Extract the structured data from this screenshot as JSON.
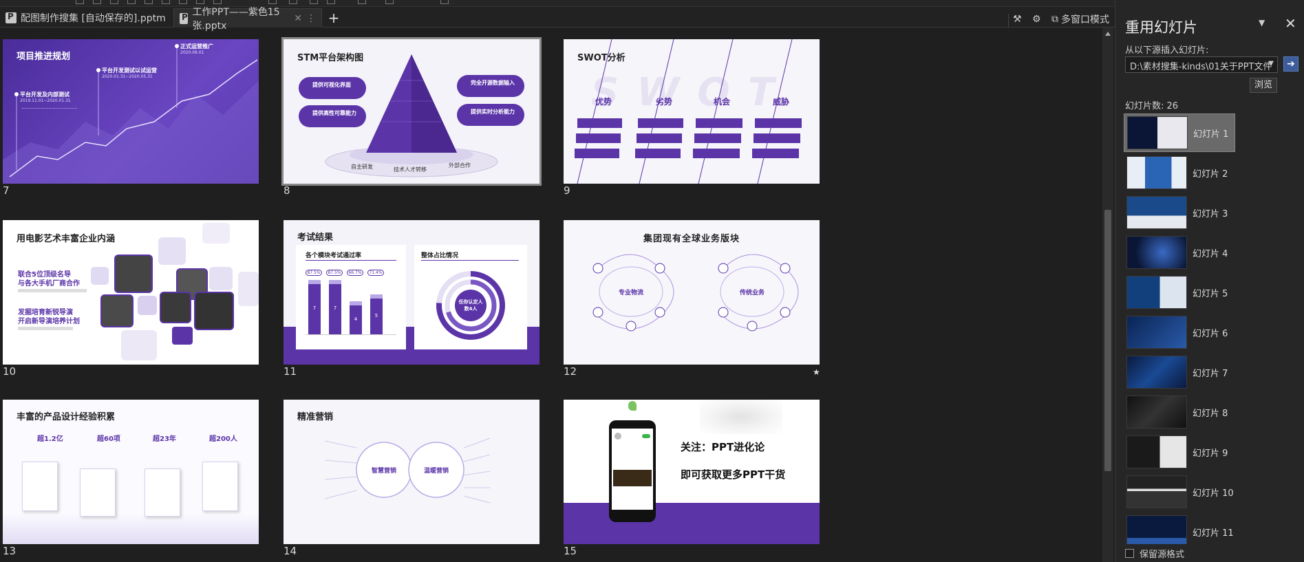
{
  "tabs": [
    {
      "label": "配图制作搜集 [自动保存的].pptm",
      "active": false
    },
    {
      "label": "工作PPT——紫色15张.pptx",
      "active": true
    }
  ],
  "toolbar": {
    "multiwindow": "多窗口模式"
  },
  "colors": {
    "accent": "#5b34a8",
    "panel_bg": "#262626",
    "app_bg": "#1f1f1f"
  },
  "slides": [
    {
      "num": "7",
      "title": "项目推进规划",
      "milestones": [
        "正式运营推广",
        "2020.06.01",
        "平台开发测试以试运营",
        "2020.01.31~2020.05.31",
        "平台开发及内部测试",
        "2019.11.01~2020.01.31"
      ]
    },
    {
      "num": "8",
      "title": "STM平台架构图",
      "left_boxes": [
        "提供可视化界面",
        "提供高性可靠能力"
      ],
      "right_boxes": [
        "完全开源数据输入",
        "提供实时分析能力"
      ],
      "base_labels": [
        "自主研发",
        "技术人才转移",
        "外部合作"
      ]
    },
    {
      "num": "9",
      "title": "SWOT分析",
      "columns": [
        "优势",
        "劣势",
        "机会",
        "威胁"
      ],
      "watermark": "SWOT"
    },
    {
      "num": "10",
      "title": "用电影艺术丰富企业内涵",
      "text1": "联合5位顶级名导",
      "text2": "与各大手机厂商合作",
      "text3": "发掘培育新锐导演",
      "text4": "开启新导演培养计划"
    },
    {
      "num": "11",
      "title": "考试结果",
      "left_sub": "各个模块考试通过率",
      "right_sub": "整体占比情况",
      "percents": [
        "87.5%",
        "87.5%",
        "66.7%",
        "71.4%"
      ],
      "bars": [
        7,
        7,
        4,
        5
      ],
      "donut_label": "任你认定人数4人"
    },
    {
      "num": "12",
      "title": "集团现有全球业务版块",
      "left_center": "专业物流",
      "right_center": "传统业务",
      "starred": true
    },
    {
      "num": "13",
      "title": "丰富的产品设计经验积累",
      "stats": [
        "超1.2亿",
        "超60项",
        "超23年",
        "超200人"
      ]
    },
    {
      "num": "14",
      "title": "精准营销",
      "left_center": "智慧营销",
      "right_center": "温暖营销"
    },
    {
      "num": "15",
      "line1": "关注：PPT进化论",
      "line2": "即可获取更多PPT干货"
    }
  ],
  "panel": {
    "title": "重用幻灯片",
    "from_label": "从以下源插入幻灯片:",
    "source_path": "D:\\素材搜集-kinds\\01关于PPT文件",
    "browse": "浏览",
    "count_label": "幻灯片数: 26",
    "keep_format": "保留源格式",
    "thumbs": [
      "幻灯片 1",
      "幻灯片 2",
      "幻灯片 3",
      "幻灯片 4",
      "幻灯片 5",
      "幻灯片 6",
      "幻灯片 7",
      "幻灯片 8",
      "幻灯片 9",
      "幻灯片 10",
      "幻灯片 11"
    ]
  }
}
